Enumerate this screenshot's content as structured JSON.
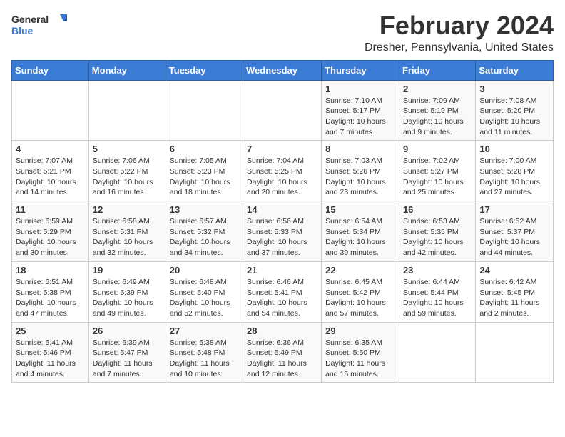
{
  "header": {
    "logo_line1": "General",
    "logo_line2": "Blue",
    "month": "February 2024",
    "location": "Dresher, Pennsylvania, United States"
  },
  "weekdays": [
    "Sunday",
    "Monday",
    "Tuesday",
    "Wednesday",
    "Thursday",
    "Friday",
    "Saturday"
  ],
  "weeks": [
    [
      {
        "day": "",
        "info": ""
      },
      {
        "day": "",
        "info": ""
      },
      {
        "day": "",
        "info": ""
      },
      {
        "day": "",
        "info": ""
      },
      {
        "day": "1",
        "info": "Sunrise: 7:10 AM\nSunset: 5:17 PM\nDaylight: 10 hours\nand 7 minutes."
      },
      {
        "day": "2",
        "info": "Sunrise: 7:09 AM\nSunset: 5:19 PM\nDaylight: 10 hours\nand 9 minutes."
      },
      {
        "day": "3",
        "info": "Sunrise: 7:08 AM\nSunset: 5:20 PM\nDaylight: 10 hours\nand 11 minutes."
      }
    ],
    [
      {
        "day": "4",
        "info": "Sunrise: 7:07 AM\nSunset: 5:21 PM\nDaylight: 10 hours\nand 14 minutes."
      },
      {
        "day": "5",
        "info": "Sunrise: 7:06 AM\nSunset: 5:22 PM\nDaylight: 10 hours\nand 16 minutes."
      },
      {
        "day": "6",
        "info": "Sunrise: 7:05 AM\nSunset: 5:23 PM\nDaylight: 10 hours\nand 18 minutes."
      },
      {
        "day": "7",
        "info": "Sunrise: 7:04 AM\nSunset: 5:25 PM\nDaylight: 10 hours\nand 20 minutes."
      },
      {
        "day": "8",
        "info": "Sunrise: 7:03 AM\nSunset: 5:26 PM\nDaylight: 10 hours\nand 23 minutes."
      },
      {
        "day": "9",
        "info": "Sunrise: 7:02 AM\nSunset: 5:27 PM\nDaylight: 10 hours\nand 25 minutes."
      },
      {
        "day": "10",
        "info": "Sunrise: 7:00 AM\nSunset: 5:28 PM\nDaylight: 10 hours\nand 27 minutes."
      }
    ],
    [
      {
        "day": "11",
        "info": "Sunrise: 6:59 AM\nSunset: 5:29 PM\nDaylight: 10 hours\nand 30 minutes."
      },
      {
        "day": "12",
        "info": "Sunrise: 6:58 AM\nSunset: 5:31 PM\nDaylight: 10 hours\nand 32 minutes."
      },
      {
        "day": "13",
        "info": "Sunrise: 6:57 AM\nSunset: 5:32 PM\nDaylight: 10 hours\nand 34 minutes."
      },
      {
        "day": "14",
        "info": "Sunrise: 6:56 AM\nSunset: 5:33 PM\nDaylight: 10 hours\nand 37 minutes."
      },
      {
        "day": "15",
        "info": "Sunrise: 6:54 AM\nSunset: 5:34 PM\nDaylight: 10 hours\nand 39 minutes."
      },
      {
        "day": "16",
        "info": "Sunrise: 6:53 AM\nSunset: 5:35 PM\nDaylight: 10 hours\nand 42 minutes."
      },
      {
        "day": "17",
        "info": "Sunrise: 6:52 AM\nSunset: 5:37 PM\nDaylight: 10 hours\nand 44 minutes."
      }
    ],
    [
      {
        "day": "18",
        "info": "Sunrise: 6:51 AM\nSunset: 5:38 PM\nDaylight: 10 hours\nand 47 minutes."
      },
      {
        "day": "19",
        "info": "Sunrise: 6:49 AM\nSunset: 5:39 PM\nDaylight: 10 hours\nand 49 minutes."
      },
      {
        "day": "20",
        "info": "Sunrise: 6:48 AM\nSunset: 5:40 PM\nDaylight: 10 hours\nand 52 minutes."
      },
      {
        "day": "21",
        "info": "Sunrise: 6:46 AM\nSunset: 5:41 PM\nDaylight: 10 hours\nand 54 minutes."
      },
      {
        "day": "22",
        "info": "Sunrise: 6:45 AM\nSunset: 5:42 PM\nDaylight: 10 hours\nand 57 minutes."
      },
      {
        "day": "23",
        "info": "Sunrise: 6:44 AM\nSunset: 5:44 PM\nDaylight: 10 hours\nand 59 minutes."
      },
      {
        "day": "24",
        "info": "Sunrise: 6:42 AM\nSunset: 5:45 PM\nDaylight: 11 hours\nand 2 minutes."
      }
    ],
    [
      {
        "day": "25",
        "info": "Sunrise: 6:41 AM\nSunset: 5:46 PM\nDaylight: 11 hours\nand 4 minutes."
      },
      {
        "day": "26",
        "info": "Sunrise: 6:39 AM\nSunset: 5:47 PM\nDaylight: 11 hours\nand 7 minutes."
      },
      {
        "day": "27",
        "info": "Sunrise: 6:38 AM\nSunset: 5:48 PM\nDaylight: 11 hours\nand 10 minutes."
      },
      {
        "day": "28",
        "info": "Sunrise: 6:36 AM\nSunset: 5:49 PM\nDaylight: 11 hours\nand 12 minutes."
      },
      {
        "day": "29",
        "info": "Sunrise: 6:35 AM\nSunset: 5:50 PM\nDaylight: 11 hours\nand 15 minutes."
      },
      {
        "day": "",
        "info": ""
      },
      {
        "day": "",
        "info": ""
      }
    ]
  ]
}
